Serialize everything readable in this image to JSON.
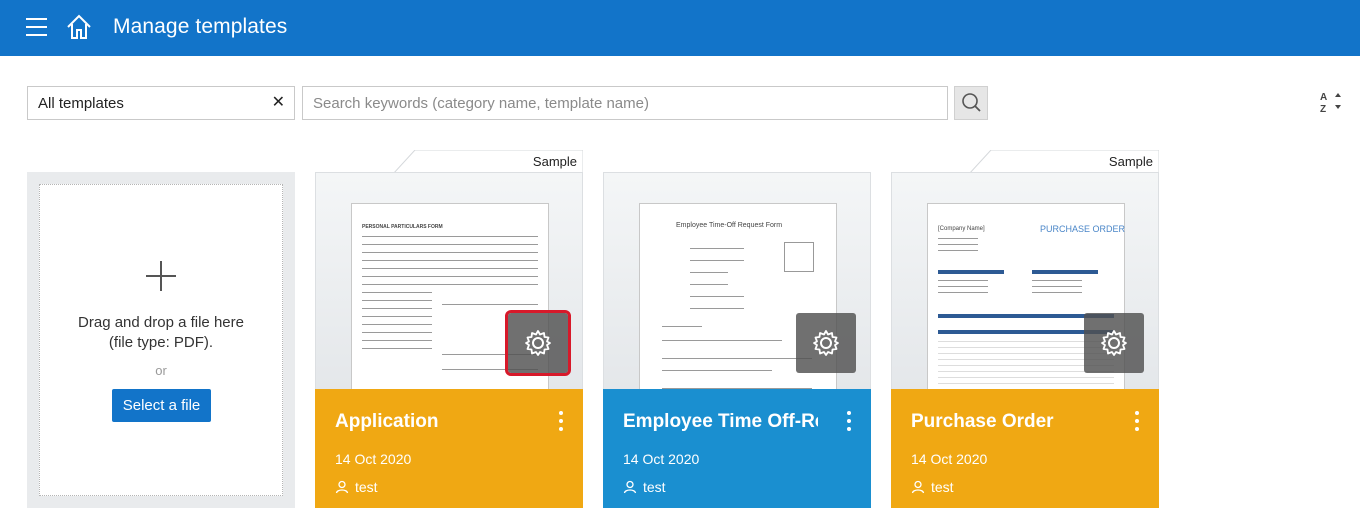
{
  "header": {
    "title": "Manage templates",
    "menu_icon": "hamburger-menu-icon",
    "home_icon": "home-icon",
    "bg_color": "#1274c9"
  },
  "toolbar": {
    "filter_value": "All templates",
    "search_placeholder": "Search keywords (category name, template name)",
    "search_icon": "search-icon",
    "sort_icon": "sort-az-icon"
  },
  "upload": {
    "drop_line1": "Drag and drop a file here",
    "drop_line2": "(file type: PDF).",
    "or_text": "or",
    "select_label": "Select a file"
  },
  "templates": [
    {
      "name": "Application",
      "date": "14 Oct 2020",
      "owner": "test",
      "badge": "Sample",
      "color": "#f0a813",
      "doc_title": "PERSONAL PARTICULARS FORM"
    },
    {
      "name": "Employee Time Off-Request",
      "date": "14 Oct 2020",
      "owner": "test",
      "badge": "",
      "color": "#1a8fd0",
      "doc_title": "Employee Time-Off Request Form"
    },
    {
      "name": "Purchase Order",
      "date": "14 Oct 2020",
      "owner": "test",
      "badge": "Sample",
      "color": "#f0a813",
      "doc_title": "PURCHASE ORDER",
      "doc_company": "[Company Name]"
    }
  ]
}
